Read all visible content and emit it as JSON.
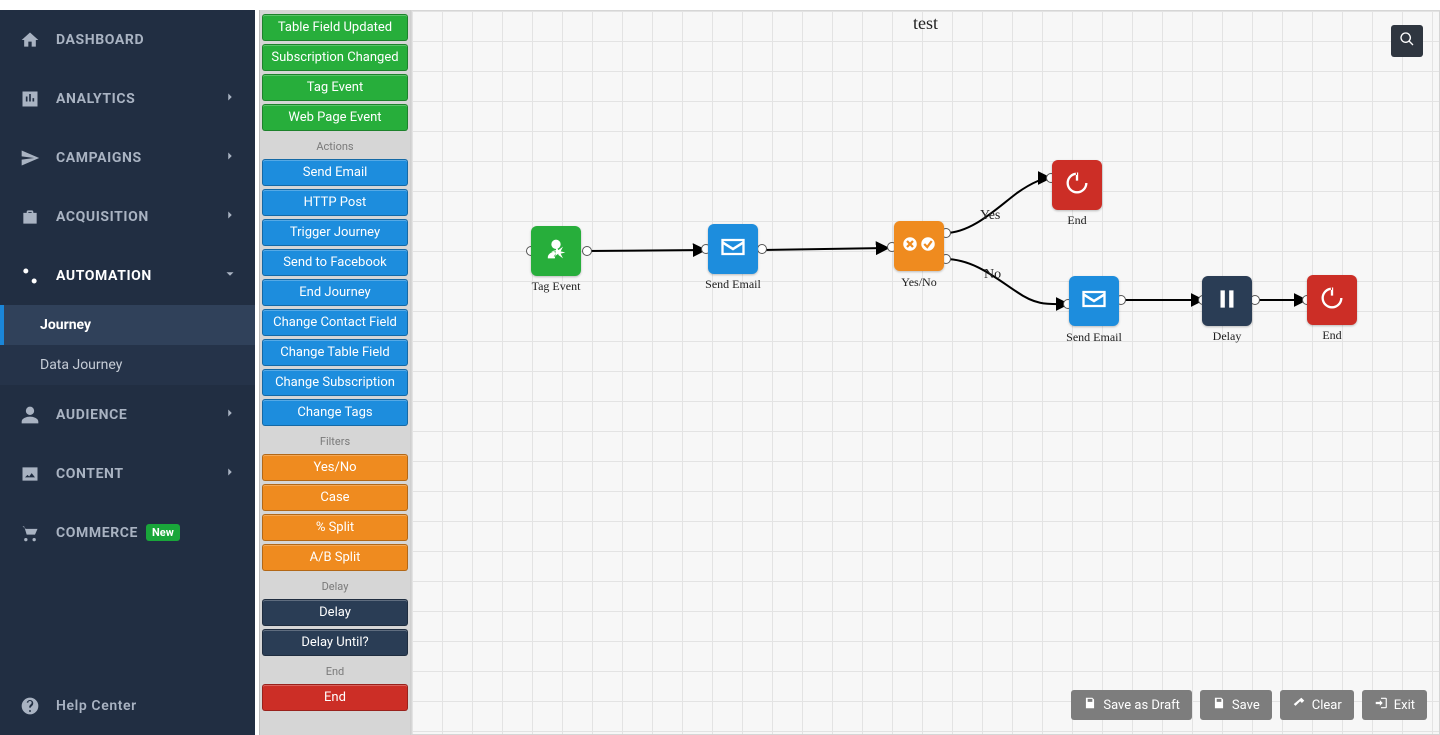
{
  "sidenav": {
    "items": [
      {
        "id": "dashboard",
        "label": "DASHBOARD",
        "chev": false
      },
      {
        "id": "analytics",
        "label": "ANALYTICS",
        "chev": true
      },
      {
        "id": "campaigns",
        "label": "CAMPAIGNS",
        "chev": true
      },
      {
        "id": "acquisition",
        "label": "ACQUISITION",
        "chev": true
      },
      {
        "id": "automation",
        "label": "AUTOMATION",
        "chev": true,
        "selected": true
      },
      {
        "id": "audience",
        "label": "AUDIENCE",
        "chev": true
      },
      {
        "id": "content",
        "label": "CONTENT",
        "chev": true
      },
      {
        "id": "commerce",
        "label": "COMMERCE",
        "chev": false,
        "badge": "New"
      }
    ],
    "automation_subs": [
      {
        "label": "Journey",
        "active": true
      },
      {
        "label": "Data Journey",
        "active": false
      }
    ],
    "help": "Help Center"
  },
  "palette": {
    "triggers": [
      "Table Field Updated",
      "Subscription Changed",
      "Tag Event",
      "Web Page Event"
    ],
    "actions_label": "Actions",
    "actions": [
      "Send Email",
      "HTTP Post",
      "Trigger Journey",
      "Send to Facebook",
      "End Journey",
      "Change Contact Field",
      "Change Table Field",
      "Change Subscription",
      "Change Tags"
    ],
    "filters_label": "Filters",
    "filters": [
      "Yes/No",
      "Case",
      "% Split",
      "A/B Split"
    ],
    "delay_label": "Delay",
    "delay": [
      "Delay",
      "Delay Until?"
    ],
    "end_label": "End",
    "end": [
      "End"
    ]
  },
  "canvas": {
    "title": "test",
    "yes": "Yes",
    "no": "No",
    "nodes": {
      "tag_event": "Tag Event",
      "send_email_1": "Send Email",
      "yesno": "Yes/No",
      "end_yes": "End",
      "send_email_2": "Send Email",
      "delay": "Delay",
      "end_no": "End"
    }
  },
  "buttons": {
    "save_draft": "Save as Draft",
    "save": "Save",
    "clear": "Clear",
    "exit": "Exit"
  }
}
